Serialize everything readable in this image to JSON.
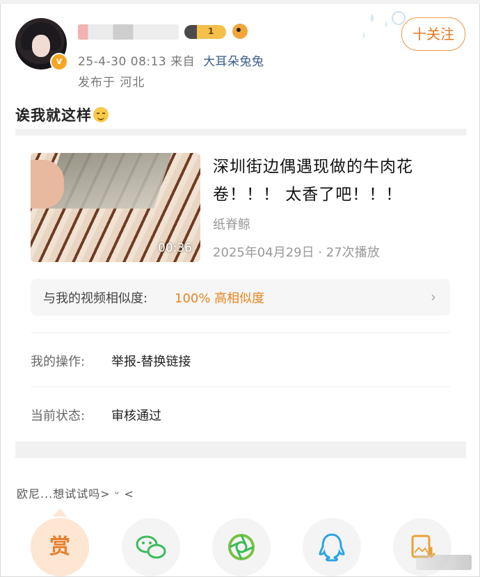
{
  "header": {
    "post_time": "25-4-30 08:13",
    "source_prefix": "来自",
    "source_name": "大耳朵兔兔",
    "location": "发布于 河北",
    "follow_label": "十关注",
    "level_number": "1"
  },
  "post": {
    "text": "诶我就这样"
  },
  "video": {
    "title": "深圳街边偶遇现做的牛肉花卷！！！ 太香了吧！！！",
    "author": "纸脊鲸",
    "date": "2025年04月29日",
    "plays": "27次播放",
    "duration": "00:36"
  },
  "similarity": {
    "label": "与我的视频相似度:",
    "value": "100% 高相似度"
  },
  "details": {
    "action_label": "我的操作:",
    "action_value": "举报-替换链接",
    "status_label": "当前状态:",
    "status_value": "审核通过"
  },
  "comment": {
    "text": "欧尼...想试试吗> ᵕ <"
  },
  "actions": {
    "reward_label": "赏"
  },
  "colors": {
    "accent_orange": "#e8851f",
    "source_blue": "#3a5c8a",
    "wechat_green": "#3dbb5a",
    "qq_blue": "#29a3e6"
  }
}
